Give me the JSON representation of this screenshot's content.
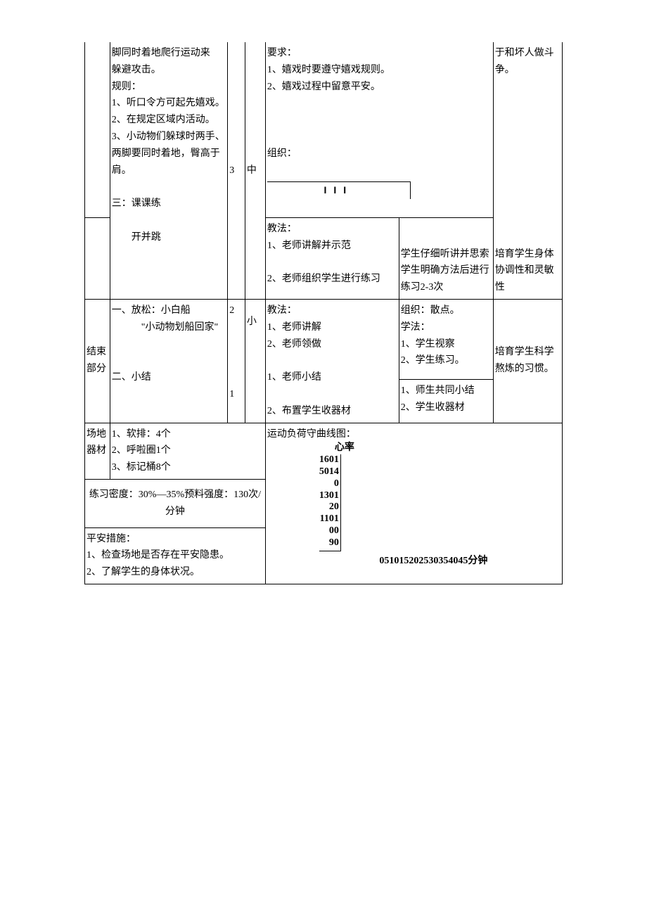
{
  "row1": {
    "col2_lines": [
      "脚同时着地爬行运动来",
      "躲避攻击。",
      "规则：",
      "1、听口令方可起先嬉戏。",
      "2、在规定区域内活动。",
      "3、小动物们躲球时两手、两脚要同时着地，臀高于肩。",
      "",
      "三：课课练",
      "",
      "　　开并跳"
    ],
    "col3": "3",
    "col4": "中",
    "col5_top": [
      "要求：",
      "1、嬉戏时要遵守嬉戏规则。",
      "2、嬉戏过程中留意平安。"
    ],
    "col5_mid_label": "组织：",
    "col5_formation": "III",
    "col5_bottom": [
      "教法：",
      "1、老师讲解并示范",
      "",
      "2、老师组织学生进行练习"
    ],
    "col6": [
      "学生仔细听讲并思索",
      "学生明确方法后进行练习2-3次"
    ],
    "col7_top": "于和坏人做斗争。",
    "col7_bottom": "培育学生身体协调性和灵敏性"
  },
  "row2": {
    "col1": "结束部分",
    "col2_a": [
      "一、放松：小白船",
      "　　　\"小动物划船回家\""
    ],
    "col2_b": "二、小结",
    "col3_a": "2",
    "col3_b": "1",
    "col4": "小",
    "col5_a": [
      "教法：",
      "1、老师讲解",
      "2、老师领做"
    ],
    "col5_b": [
      "1、老师小结",
      "",
      "2、布置学生收器材"
    ],
    "col6_a": [
      "组织：散点。",
      "学法：",
      "1、学生视察",
      "2、学生练习。"
    ],
    "col6_b": [
      "1、师生共同小结",
      "2、学生收器材"
    ],
    "col7": "培育学生科学熬炼的习惯。"
  },
  "row3": {
    "label": "场地器材",
    "items": [
      "1、软排：4个",
      "2、呼啦圈1个",
      "3、标记桶8个"
    ],
    "load_label": "运动负荷",
    "chart_title": "守曲线图：",
    "y_label": "心率"
  },
  "row4": {
    "text": "练习密度：30%—35%预料强度：130次/分钟"
  },
  "row5": {
    "lines": [
      "平安措施：",
      "1、检查场地是否存在平安隐患。",
      "2、了解学生的身体状况。"
    ]
  },
  "chart_data": {
    "type": "line",
    "title": "守曲线图：",
    "xlabel": "分钟",
    "ylabel": "心率",
    "x_ticks": [
      "0",
      "5",
      "10",
      "15",
      "20",
      "25",
      "30",
      "35",
      "40",
      "45"
    ],
    "y_ticks": [
      "90",
      "100",
      "110",
      "120",
      "130",
      "140",
      "150",
      "160"
    ],
    "x_ticks_raw": "051015202530354045分钟",
    "y_ticks_raw": [
      "1601",
      "5014",
      "0",
      "1301",
      "20",
      "1101",
      "00",
      "90"
    ],
    "values": []
  }
}
